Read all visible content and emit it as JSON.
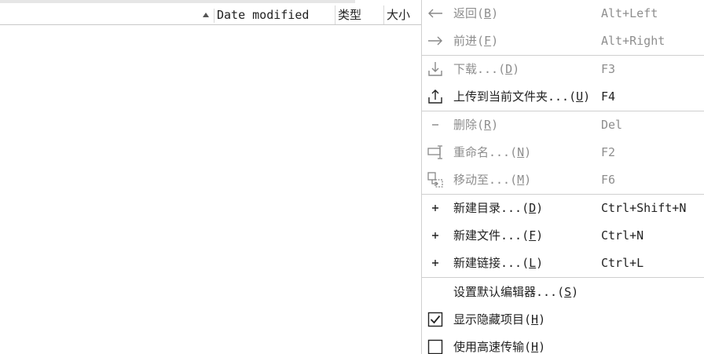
{
  "file_list": {
    "columns": {
      "date_modified": "Date modified",
      "type": "类型",
      "size": "大小"
    }
  },
  "context_menu": {
    "items": [
      {
        "id": "back",
        "pre": "返回(",
        "key": "B",
        "post": ")",
        "shortcut": "Alt+Left",
        "icon": "arrow-left-icon",
        "enabled": false
      },
      {
        "id": "forward",
        "pre": "前进(",
        "key": "F",
        "post": ")",
        "shortcut": "Alt+Right",
        "icon": "arrow-right-icon",
        "enabled": false
      },
      {
        "id": "download",
        "pre": "下载...(",
        "key": "D",
        "post": ")",
        "shortcut": "F3",
        "icon": "download-icon",
        "enabled": false
      },
      {
        "id": "upload",
        "pre": "上传到当前文件夹...(",
        "key": "U",
        "post": ")",
        "shortcut": "F4",
        "icon": "upload-icon",
        "enabled": true
      },
      {
        "id": "delete",
        "pre": "删除(",
        "key": "R",
        "post": ")",
        "shortcut": "Del",
        "icon": "minus-icon",
        "enabled": false
      },
      {
        "id": "rename",
        "pre": "重命名...(",
        "key": "N",
        "post": ")",
        "shortcut": "F2",
        "icon": "rename-icon",
        "enabled": false
      },
      {
        "id": "move",
        "pre": "移动至...(",
        "key": "M",
        "post": ")",
        "shortcut": "F6",
        "icon": "move-icon",
        "enabled": false
      },
      {
        "id": "new-dir",
        "pre": "新建目录...(",
        "key": "D",
        "post": ")",
        "shortcut": "Ctrl+Shift+N",
        "icon": "plus-icon",
        "enabled": true
      },
      {
        "id": "new-file",
        "pre": "新建文件...(",
        "key": "F",
        "post": ")",
        "shortcut": "Ctrl+N",
        "icon": "plus-icon",
        "enabled": true
      },
      {
        "id": "new-link",
        "pre": "新建链接...(",
        "key": "L",
        "post": ")",
        "shortcut": "Ctrl+L",
        "icon": "plus-icon",
        "enabled": true
      },
      {
        "id": "default-editor",
        "pre": "设置默认编辑器...(",
        "key": "S",
        "post": ")",
        "shortcut": "",
        "icon": "",
        "enabled": true
      },
      {
        "id": "show-hidden",
        "pre": "显示隐藏项目(",
        "key": "H",
        "post": ")",
        "shortcut": "",
        "icon": "checkbox-checked-icon",
        "enabled": true,
        "checked": true
      },
      {
        "id": "fast-transfer",
        "pre": "使用高速传输(",
        "key": "H",
        "post": ")",
        "shortcut": "",
        "icon": "checkbox-unchecked-icon",
        "enabled": true,
        "checked": false
      }
    ]
  }
}
